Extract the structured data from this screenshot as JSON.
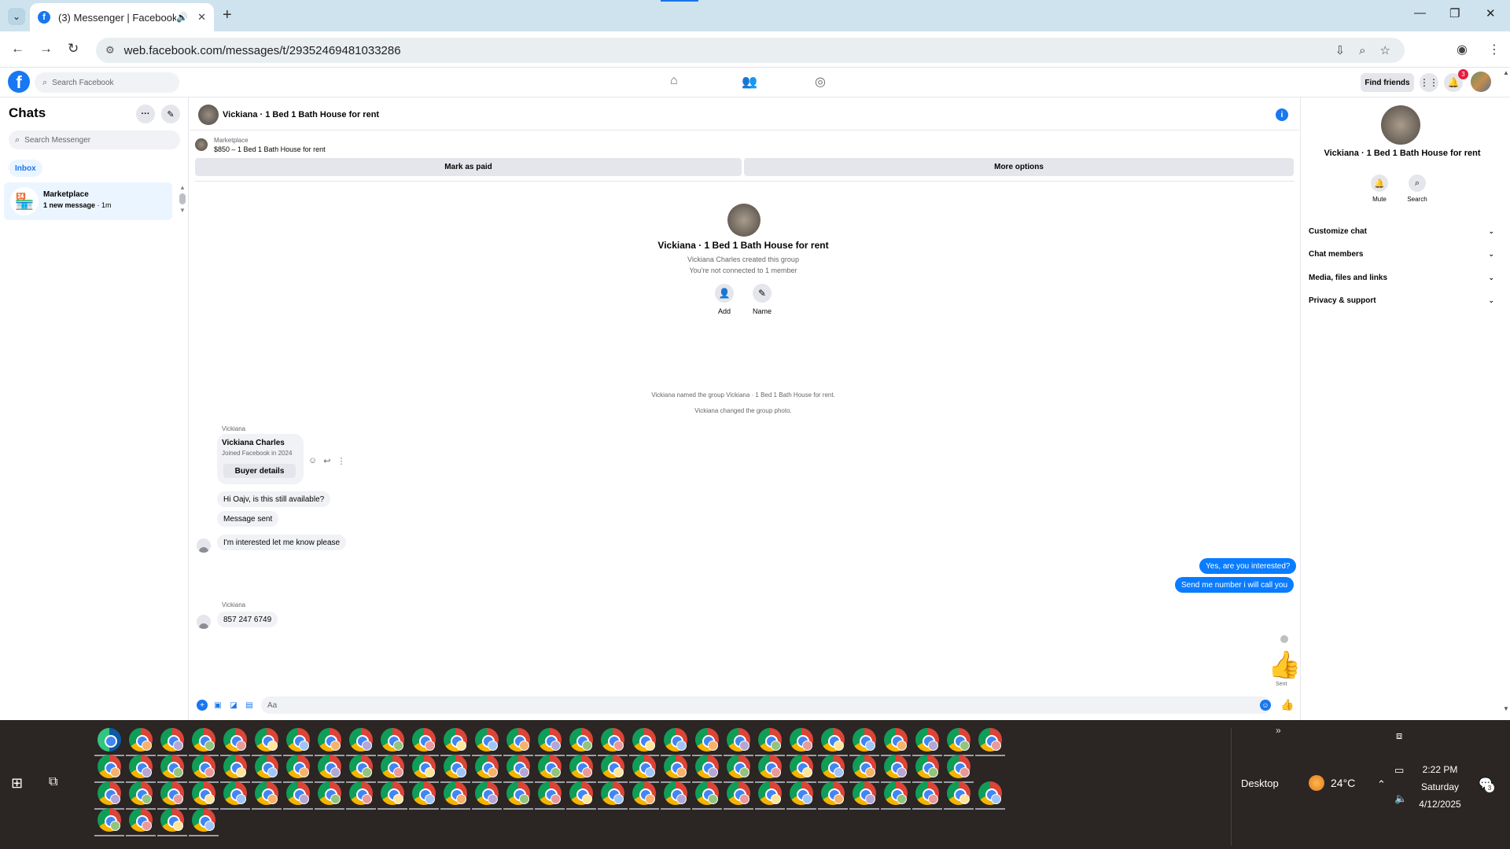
{
  "browser": {
    "tab_title": "(3) Messenger | Facebook",
    "url": "web.facebook.com/messages/t/29352469481033286",
    "tab_dropdown_icon": "chevron-down-icon",
    "new_tab_icon": "plus-icon"
  },
  "fb": {
    "search_placeholder": "Search Facebook",
    "find_friends": "Find friends",
    "notification_count": "3"
  },
  "sidebar": {
    "title": "Chats",
    "search_placeholder": "Search Messenger",
    "filter": "Inbox",
    "chat": {
      "name": "Marketplace",
      "preview_bold": "1 new message",
      "preview_time": " · 1m"
    }
  },
  "chat": {
    "title": "Vickiana · 1 Bed 1 Bath House for rent",
    "marketplace_label": "Marketplace",
    "listing": "$850 – 1 Bed 1 Bath House for rent",
    "mark_paid": "Mark as paid",
    "more_options": "More options",
    "group_name": "Vickiana · 1 Bed 1 Bath House for rent",
    "created_by": "Vickiana Charles created this group",
    "connection": "You're not connected to 1 member",
    "add_label": "Add",
    "name_label": "Name",
    "system_1": "Vickiana named the group Vickiana · 1 Bed 1 Bath House for rent.",
    "system_2": "Vickiana changed the group photo.",
    "sender_1": "Vickiana",
    "buyer_name": "Vickiana Charles",
    "buyer_sub": "Joined Facebook in 2024",
    "buyer_btn": "Buyer details",
    "msg_1": "Hi Oajv, is this still available?",
    "msg_2": "Message sent",
    "msg_3": "I'm interested let me know please",
    "out_1": "Yes, are you interested?",
    "out_2": "Send me number i will call you",
    "sender_2": "Vickiana",
    "msg_4": "857 247 6749",
    "sent_label": "Sent",
    "composer_placeholder": "Aa"
  },
  "panel": {
    "name": "Vickiana · 1 Bed 1 Bath House for rent",
    "mute": "Mute",
    "search": "Search",
    "rows": [
      "Customize chat",
      "Chat members",
      "Media, files and links",
      "Privacy & support"
    ]
  },
  "taskbar": {
    "desktop": "Desktop",
    "temperature": "24°C",
    "time": "2:22 PM",
    "day": "Saturday",
    "date": "4/12/2025",
    "notif_count": "3"
  }
}
